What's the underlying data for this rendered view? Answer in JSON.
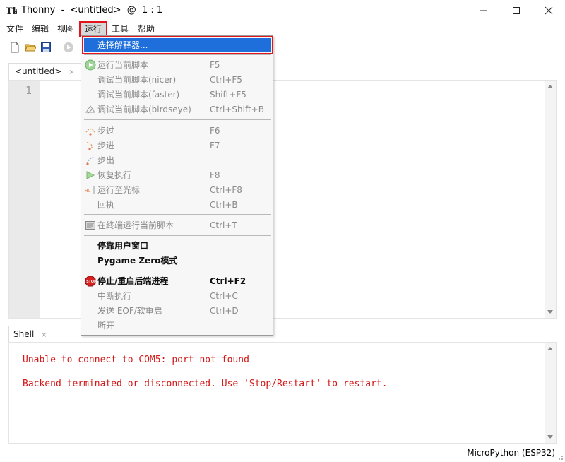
{
  "window": {
    "title": "Thonny  -  <untitled>  @  1 : 1",
    "logo": "thonny-logo",
    "controls": [
      "minimize-icon",
      "maximize-icon",
      "close-icon"
    ]
  },
  "menubar": {
    "items": [
      "文件",
      "编辑",
      "视图",
      "运行",
      "工具",
      "帮助"
    ],
    "active_index": 3
  },
  "toolbar": {
    "icons": [
      "new-file-icon",
      "open-folder-icon",
      "save-icon",
      "run-icon"
    ]
  },
  "editor": {
    "tab_label": "<untitled>",
    "tab_close": "×",
    "line_numbers": [
      "1"
    ]
  },
  "shell": {
    "tab_label": "Shell",
    "tab_close": "×",
    "lines": [
      "Unable to connect to COM5: port not found",
      "Backend terminated or disconnected. Use 'Stop/Restart' to restart."
    ],
    "error_color": "#d41818"
  },
  "status": {
    "interpreter": "MicroPython (ESP32)"
  },
  "run_menu": {
    "highlight_color": "#1e6fdc",
    "items": [
      {
        "label": "选择解释器...",
        "shortcut": "",
        "state": "highlight",
        "icon": ""
      },
      {
        "label": "运行当前脚本",
        "shortcut": "F5",
        "state": "disabled",
        "icon": "run-icon"
      },
      {
        "label": "调试当前脚本(nicer)",
        "shortcut": "Ctrl+F5",
        "state": "disabled",
        "icon": ""
      },
      {
        "label": "调试当前脚本(faster)",
        "shortcut": "Shift+F5",
        "state": "disabled",
        "icon": ""
      },
      {
        "label": "调试当前脚本(birdseye)",
        "shortcut": "Ctrl+Shift+B",
        "state": "disabled",
        "icon": "birdseye-icon"
      },
      {
        "label": "步过",
        "shortcut": "F6",
        "state": "disabled",
        "icon": "step-over-icon"
      },
      {
        "label": "步进",
        "shortcut": "F7",
        "state": "disabled",
        "icon": "step-into-icon"
      },
      {
        "label": "步出",
        "shortcut": "",
        "state": "disabled",
        "icon": "step-out-icon"
      },
      {
        "label": "恢复执行",
        "shortcut": "F8",
        "state": "disabled",
        "icon": "resume-icon"
      },
      {
        "label": "运行至光标",
        "shortcut": "Ctrl+F8",
        "state": "disabled",
        "icon": "run-to-cursor-icon"
      },
      {
        "label": "回执",
        "shortcut": "Ctrl+B",
        "state": "disabled",
        "icon": ""
      },
      {
        "label": "在终端运行当前脚本",
        "shortcut": "Ctrl+T",
        "state": "disabled",
        "icon": "terminal-icon"
      },
      {
        "label": "停靠用户窗口",
        "shortcut": "",
        "state": "enabled",
        "icon": ""
      },
      {
        "label": "Pygame Zero模式",
        "shortcut": "",
        "state": "enabled",
        "icon": ""
      },
      {
        "label": "停止/重启后端进程",
        "shortcut": "Ctrl+F2",
        "state": "enabled",
        "icon": "stop-icon"
      },
      {
        "label": "中断执行",
        "shortcut": "Ctrl+C",
        "state": "disabled",
        "icon": ""
      },
      {
        "label": "发送 EOF/软重启",
        "shortcut": "Ctrl+D",
        "state": "disabled",
        "icon": ""
      },
      {
        "label": "断开",
        "shortcut": "",
        "state": "disabled",
        "icon": ""
      }
    ]
  }
}
